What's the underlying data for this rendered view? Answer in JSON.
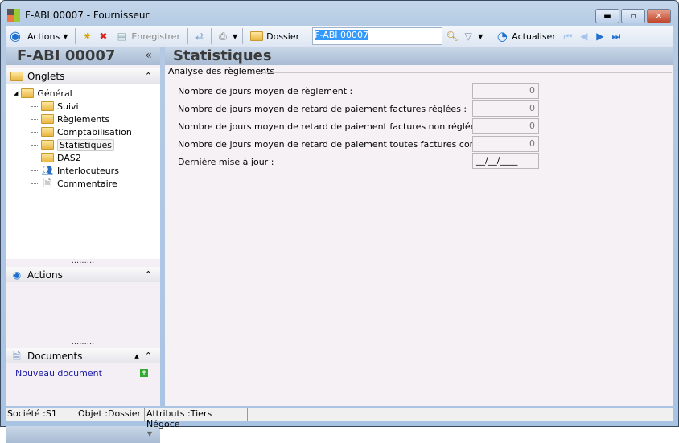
{
  "window": {
    "title": "F-ABI 00007 -  Fournisseur"
  },
  "toolbar": {
    "actions": "Actions",
    "save": "Enregistrer",
    "folder": "Dossier",
    "search_value": "F-ABI 00007",
    "refresh": "Actualiser"
  },
  "sidebar": {
    "title": "F-ABI 00007",
    "collapse": "«",
    "onglets": {
      "label": "Onglets",
      "root": "Général",
      "items": [
        "Suivi",
        "Règlements",
        "Comptabilisation",
        "Statistiques",
        "DAS2",
        "Interlocuteurs",
        "Commentaire"
      ],
      "selected": "Statistiques"
    },
    "actions": {
      "label": "Actions"
    },
    "documents": {
      "label": "Documents",
      "new_doc": "Nouveau document"
    }
  },
  "main": {
    "title": "Statistiques",
    "group": "Analyse des règlements",
    "fields": [
      {
        "label": "Nombre de jours moyen de règlement :",
        "value": "0"
      },
      {
        "label": "Nombre de jours moyen de retard de paiement factures réglées :",
        "value": "0"
      },
      {
        "label": "Nombre de jours moyen de retard de paiement factures non réglées :",
        "value": "0"
      },
      {
        "label": "Nombre de jours moyen de retard de paiement toutes factures confondues :",
        "value": "0"
      },
      {
        "label": "Dernière mise à jour :",
        "value": "__/__/____"
      }
    ]
  },
  "status": {
    "societe": "Société :S1",
    "objet": "Objet :Dossier",
    "attributs": "Attributs :Tiers Négoce"
  }
}
